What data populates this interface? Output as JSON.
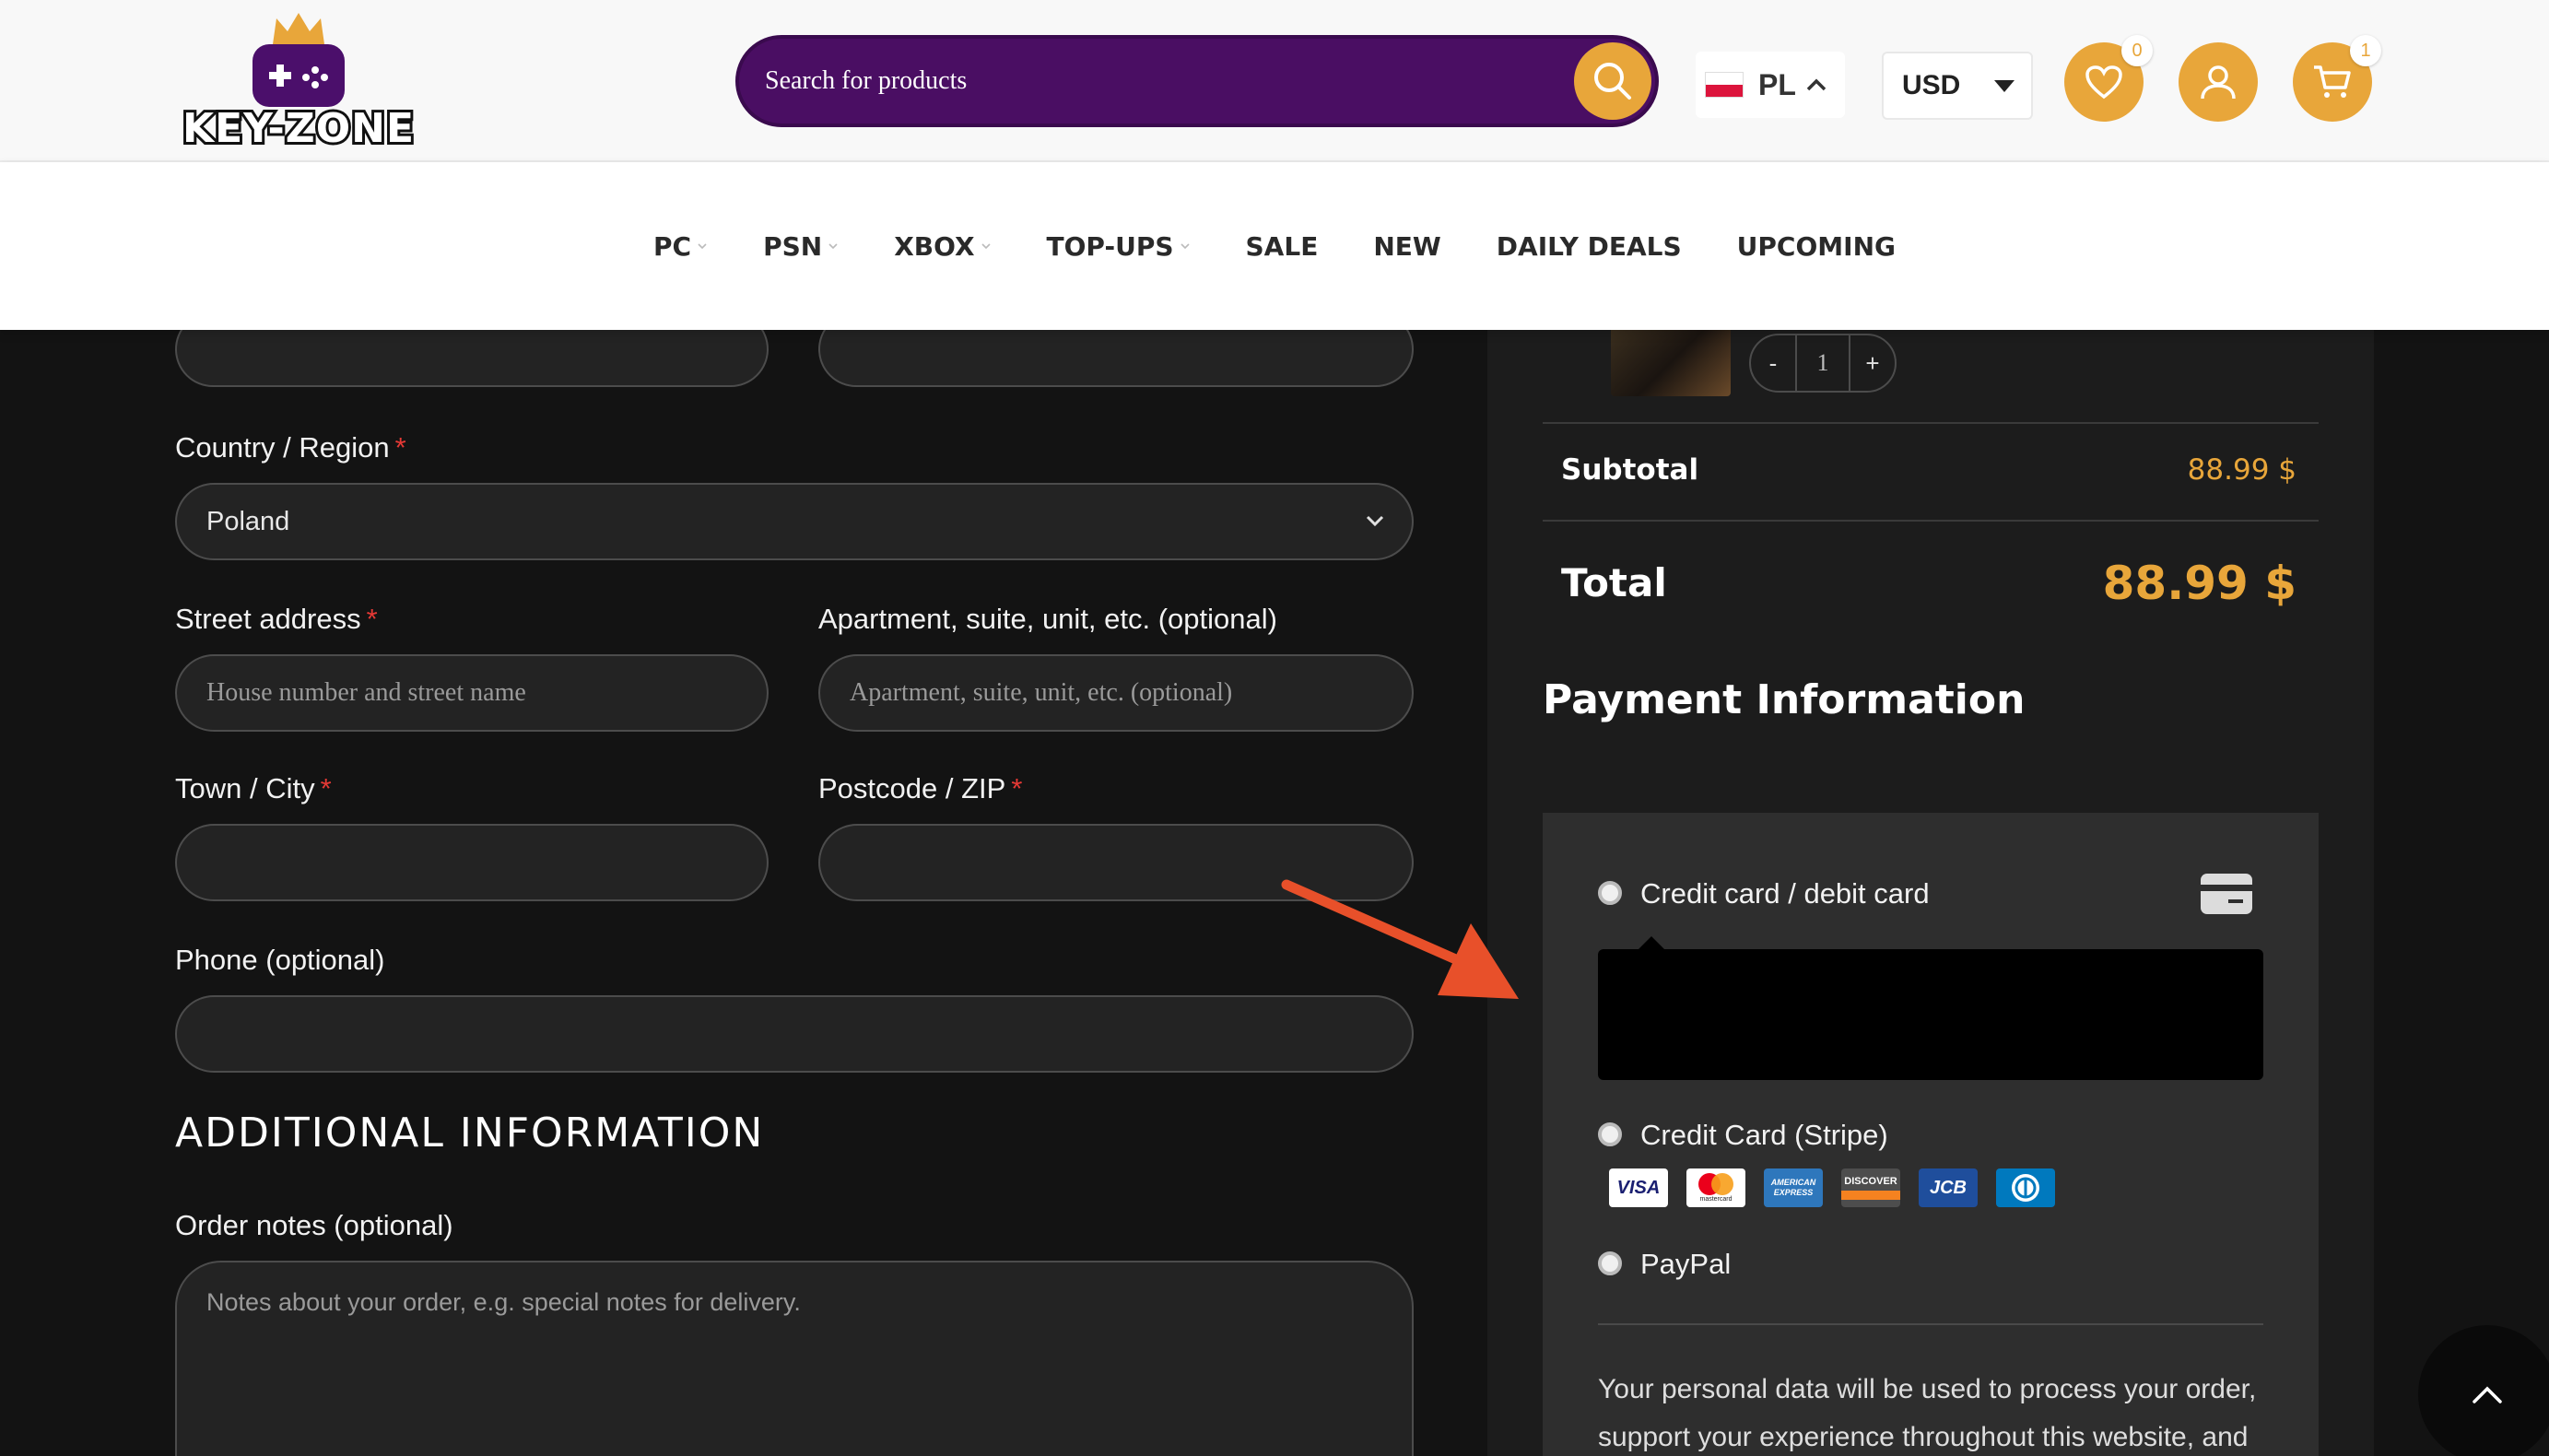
{
  "header": {
    "logo_text": "KEY-ZONE",
    "search": {
      "placeholder": "Search for products"
    },
    "language": {
      "code": "PL"
    },
    "currency": {
      "code": "USD"
    },
    "wishlist": {
      "count": "0"
    },
    "cart": {
      "count": "1"
    },
    "nav": [
      {
        "label": "PC",
        "has_dropdown": true
      },
      {
        "label": "PSN",
        "has_dropdown": true
      },
      {
        "label": "XBOX",
        "has_dropdown": true
      },
      {
        "label": "TOP-UPS",
        "has_dropdown": true
      },
      {
        "label": "SALE",
        "has_dropdown": false
      },
      {
        "label": "NEW",
        "has_dropdown": false
      },
      {
        "label": "DAILY DEALS",
        "has_dropdown": false
      },
      {
        "label": "UPCOMING",
        "has_dropdown": false
      }
    ]
  },
  "form": {
    "country": {
      "label": "Country / Region",
      "required": "*",
      "value": "Poland"
    },
    "street": {
      "label": "Street address",
      "required": "*",
      "placeholder": "House number and street name"
    },
    "apartment": {
      "label": "Apartment, suite, unit, etc. (optional)",
      "placeholder": "Apartment, suite, unit, etc. (optional)"
    },
    "city": {
      "label": "Town / City",
      "required": "*"
    },
    "postcode": {
      "label": "Postcode / ZIP",
      "required": "*"
    },
    "phone": {
      "label": "Phone (optional)"
    },
    "additional_title": "ADDITIONAL INFORMATION",
    "notes": {
      "label": "Order notes (optional)",
      "placeholder": "Notes about your order, e.g. special notes for delivery."
    }
  },
  "order": {
    "quantity": {
      "minus": "-",
      "value": "1",
      "plus": "+"
    },
    "subtotal": {
      "label": "Subtotal",
      "value": "88.99 $"
    },
    "total": {
      "label": "Total",
      "value": "88.99 $"
    },
    "payment_title": "Payment Information",
    "methods": [
      {
        "label": "Credit card / debit card"
      },
      {
        "label": "Credit Card (Stripe)"
      },
      {
        "label": "PayPal"
      }
    ],
    "card_brands": [
      {
        "name": "VISA",
        "bg": "#ffffff",
        "fg": "#1a1f71"
      },
      {
        "name": "mastercard",
        "bg": "#ffffff",
        "fg": "#222222"
      },
      {
        "name": "AMERICAN EXPRESS",
        "bg": "#2e77bc",
        "fg": "#ffffff"
      },
      {
        "name": "DISCOVER",
        "bg": "#4d4d4d",
        "fg": "#ffffff"
      },
      {
        "name": "JCB",
        "bg": "#1f4e9c",
        "fg": "#ffffff"
      },
      {
        "name": "Diners",
        "bg": "#0079be",
        "fg": "#ffffff"
      }
    ],
    "privacy_text": "Your personal data will be used to process your order, support your experience throughout this website, and"
  },
  "colors": {
    "accent": "#e8a63a",
    "brand_purple": "#4a0e63",
    "background": "#131313",
    "panel": "#1c1c1c",
    "annotation_arrow": "#e8502a"
  },
  "icons": [
    "search-icon",
    "chevron-up-icon",
    "heart-icon",
    "user-icon",
    "cart-icon",
    "chevron-down-icon",
    "credit-card-icon",
    "arrow-up-icon"
  ]
}
